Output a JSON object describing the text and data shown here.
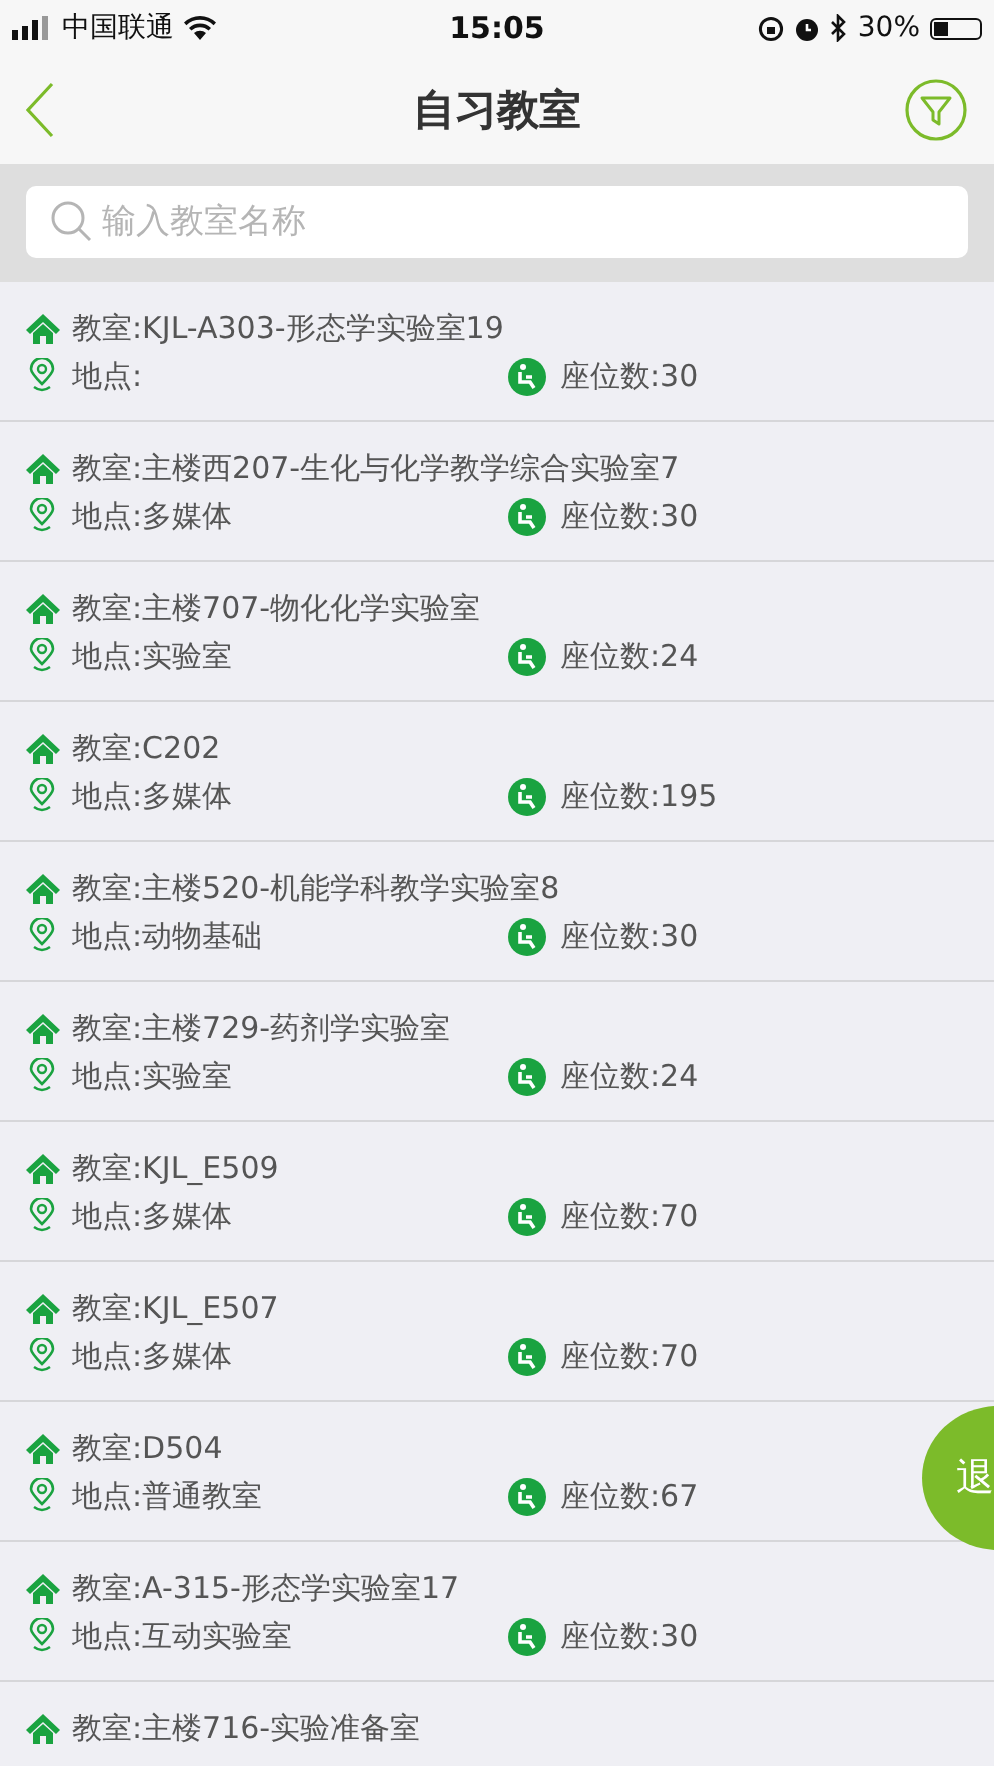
{
  "status_bar": {
    "carrier": "中国联通",
    "time": "15:05",
    "battery": "30%"
  },
  "nav": {
    "title": "自习教室"
  },
  "search": {
    "placeholder": "输入教室名称"
  },
  "rooms": [
    {
      "name": "教室:KJL-A303-形态学实验室19",
      "location": "地点:",
      "seats": "座位数:30"
    },
    {
      "name": "教室:主楼西207-生化与化学教学综合实验室7",
      "location": "地点:多媒体",
      "seats": "座位数:30"
    },
    {
      "name": "教室:主楼707-物化化学实验室",
      "location": "地点:实验室",
      "seats": "座位数:24"
    },
    {
      "name": "教室:C202",
      "location": "地点:多媒体",
      "seats": "座位数:195"
    },
    {
      "name": "教室:主楼520-机能学科教学实验室8",
      "location": "地点:动物基础",
      "seats": "座位数:30"
    },
    {
      "name": "教室:主楼729-药剂学实验室",
      "location": "地点:实验室",
      "seats": "座位数:24"
    },
    {
      "name": "教室:KJL_E509",
      "location": "地点:多媒体",
      "seats": "座位数:70"
    },
    {
      "name": "教室:KJL_E507",
      "location": "地点:多媒体",
      "seats": "座位数:70"
    },
    {
      "name": "教室:D504",
      "location": "地点:普通教室",
      "seats": "座位数:67"
    },
    {
      "name": "教室:A-315-形态学实验室17",
      "location": "地点:互动实验室",
      "seats": "座位数:30"
    },
    {
      "name": "教室:主楼716-实验准备室"
    }
  ],
  "float_button": {
    "label": "退"
  }
}
